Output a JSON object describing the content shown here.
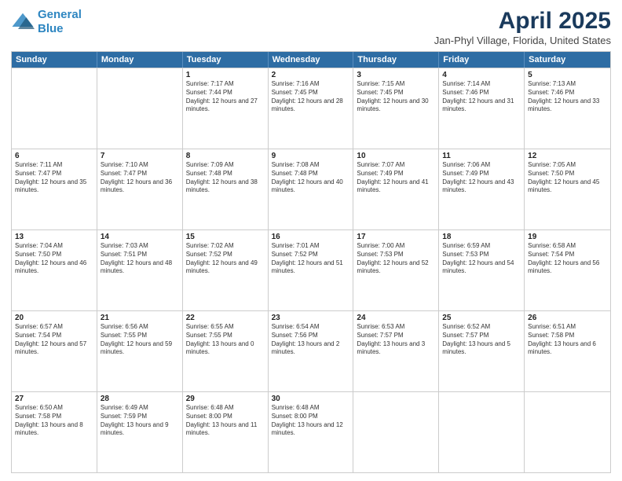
{
  "logo": {
    "line1": "General",
    "line2": "Blue"
  },
  "title": "April 2025",
  "subtitle": "Jan-Phyl Village, Florida, United States",
  "days_of_week": [
    "Sunday",
    "Monday",
    "Tuesday",
    "Wednesday",
    "Thursday",
    "Friday",
    "Saturday"
  ],
  "weeks": [
    [
      {
        "day": "",
        "info": ""
      },
      {
        "day": "",
        "info": ""
      },
      {
        "day": "1",
        "info": "Sunrise: 7:17 AM\nSunset: 7:44 PM\nDaylight: 12 hours and 27 minutes."
      },
      {
        "day": "2",
        "info": "Sunrise: 7:16 AM\nSunset: 7:45 PM\nDaylight: 12 hours and 28 minutes."
      },
      {
        "day": "3",
        "info": "Sunrise: 7:15 AM\nSunset: 7:45 PM\nDaylight: 12 hours and 30 minutes."
      },
      {
        "day": "4",
        "info": "Sunrise: 7:14 AM\nSunset: 7:46 PM\nDaylight: 12 hours and 31 minutes."
      },
      {
        "day": "5",
        "info": "Sunrise: 7:13 AM\nSunset: 7:46 PM\nDaylight: 12 hours and 33 minutes."
      }
    ],
    [
      {
        "day": "6",
        "info": "Sunrise: 7:11 AM\nSunset: 7:47 PM\nDaylight: 12 hours and 35 minutes."
      },
      {
        "day": "7",
        "info": "Sunrise: 7:10 AM\nSunset: 7:47 PM\nDaylight: 12 hours and 36 minutes."
      },
      {
        "day": "8",
        "info": "Sunrise: 7:09 AM\nSunset: 7:48 PM\nDaylight: 12 hours and 38 minutes."
      },
      {
        "day": "9",
        "info": "Sunrise: 7:08 AM\nSunset: 7:48 PM\nDaylight: 12 hours and 40 minutes."
      },
      {
        "day": "10",
        "info": "Sunrise: 7:07 AM\nSunset: 7:49 PM\nDaylight: 12 hours and 41 minutes."
      },
      {
        "day": "11",
        "info": "Sunrise: 7:06 AM\nSunset: 7:49 PM\nDaylight: 12 hours and 43 minutes."
      },
      {
        "day": "12",
        "info": "Sunrise: 7:05 AM\nSunset: 7:50 PM\nDaylight: 12 hours and 45 minutes."
      }
    ],
    [
      {
        "day": "13",
        "info": "Sunrise: 7:04 AM\nSunset: 7:50 PM\nDaylight: 12 hours and 46 minutes."
      },
      {
        "day": "14",
        "info": "Sunrise: 7:03 AM\nSunset: 7:51 PM\nDaylight: 12 hours and 48 minutes."
      },
      {
        "day": "15",
        "info": "Sunrise: 7:02 AM\nSunset: 7:52 PM\nDaylight: 12 hours and 49 minutes."
      },
      {
        "day": "16",
        "info": "Sunrise: 7:01 AM\nSunset: 7:52 PM\nDaylight: 12 hours and 51 minutes."
      },
      {
        "day": "17",
        "info": "Sunrise: 7:00 AM\nSunset: 7:53 PM\nDaylight: 12 hours and 52 minutes."
      },
      {
        "day": "18",
        "info": "Sunrise: 6:59 AM\nSunset: 7:53 PM\nDaylight: 12 hours and 54 minutes."
      },
      {
        "day": "19",
        "info": "Sunrise: 6:58 AM\nSunset: 7:54 PM\nDaylight: 12 hours and 56 minutes."
      }
    ],
    [
      {
        "day": "20",
        "info": "Sunrise: 6:57 AM\nSunset: 7:54 PM\nDaylight: 12 hours and 57 minutes."
      },
      {
        "day": "21",
        "info": "Sunrise: 6:56 AM\nSunset: 7:55 PM\nDaylight: 12 hours and 59 minutes."
      },
      {
        "day": "22",
        "info": "Sunrise: 6:55 AM\nSunset: 7:55 PM\nDaylight: 13 hours and 0 minutes."
      },
      {
        "day": "23",
        "info": "Sunrise: 6:54 AM\nSunset: 7:56 PM\nDaylight: 13 hours and 2 minutes."
      },
      {
        "day": "24",
        "info": "Sunrise: 6:53 AM\nSunset: 7:57 PM\nDaylight: 13 hours and 3 minutes."
      },
      {
        "day": "25",
        "info": "Sunrise: 6:52 AM\nSunset: 7:57 PM\nDaylight: 13 hours and 5 minutes."
      },
      {
        "day": "26",
        "info": "Sunrise: 6:51 AM\nSunset: 7:58 PM\nDaylight: 13 hours and 6 minutes."
      }
    ],
    [
      {
        "day": "27",
        "info": "Sunrise: 6:50 AM\nSunset: 7:58 PM\nDaylight: 13 hours and 8 minutes."
      },
      {
        "day": "28",
        "info": "Sunrise: 6:49 AM\nSunset: 7:59 PM\nDaylight: 13 hours and 9 minutes."
      },
      {
        "day": "29",
        "info": "Sunrise: 6:48 AM\nSunset: 8:00 PM\nDaylight: 13 hours and 11 minutes."
      },
      {
        "day": "30",
        "info": "Sunrise: 6:48 AM\nSunset: 8:00 PM\nDaylight: 13 hours and 12 minutes."
      },
      {
        "day": "",
        "info": ""
      },
      {
        "day": "",
        "info": ""
      },
      {
        "day": "",
        "info": ""
      }
    ]
  ]
}
